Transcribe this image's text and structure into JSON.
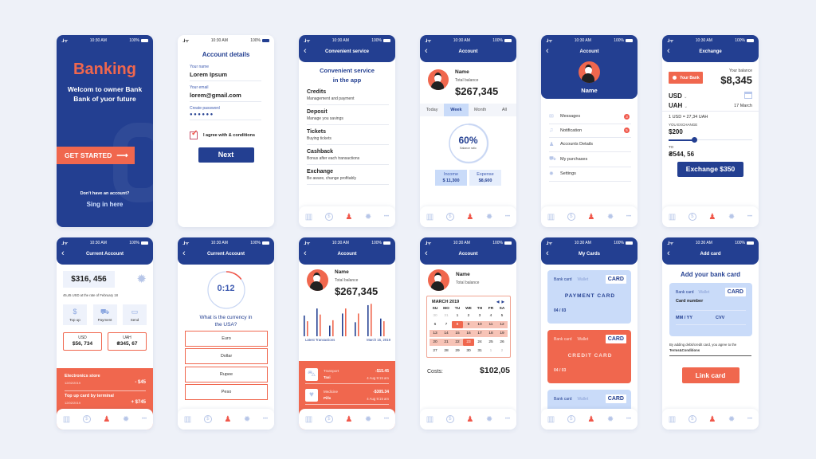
{
  "status_bar": {
    "time": "10:30 AM",
    "battery": "100%",
    "signal": "..ıl ᯤ"
  },
  "bottom_nav": {
    "icons": [
      "chart-icon",
      "dollar-icon",
      "profile-icon",
      "gear-icon",
      "more-icon"
    ],
    "glyphs": [
      "▥",
      "$",
      "♟",
      "✹",
      "•••"
    ]
  },
  "welcome": {
    "title": "Banking",
    "subtitle_line1": "Welcom to owner Bank",
    "subtitle_line2": "Bank of yuor future",
    "cta": "GET STARTED",
    "cta_arrow": "⟶",
    "no_account": "Don't have an account?",
    "sign_in": "Sing in here"
  },
  "account_details": {
    "title": "Account details",
    "fields": [
      {
        "label": "Your name",
        "value": "Lorem Ipsum"
      },
      {
        "label": "Your email",
        "value": "lorem@gmail.com"
      },
      {
        "label": "Create password",
        "value": "●●●●●●"
      }
    ],
    "checkbox_label": "I agree with & conditions",
    "checked": true,
    "next": "Next"
  },
  "services": {
    "header": "Convenient service",
    "title_line1": "Convenient service",
    "title_line2": "in the app",
    "items": [
      {
        "title": "Credits",
        "desc": "Management and payment"
      },
      {
        "title": "Deposit",
        "desc": "Manage you savings"
      },
      {
        "title": "Tickets",
        "desc": "Buying tickets"
      },
      {
        "title": "Cashback",
        "desc": "Bonus after each transactions"
      },
      {
        "title": "Exchange",
        "desc": "Be aware, change profitably"
      }
    ]
  },
  "account_ratio": {
    "header": "Account",
    "name": "Name",
    "balance_label": "Total balance",
    "balance": "$267,345",
    "tabs": [
      "Today",
      "Week",
      "Month",
      "All"
    ],
    "active_tab": "Week",
    "ratio": "60%",
    "ratio_value": 0.6,
    "ratio_label": "Balance ratio",
    "income_label": "Income",
    "income": "$ 11,300",
    "expense_label": "Expense",
    "expense": "$8,600"
  },
  "account_menu": {
    "header": "Account",
    "name": "Name",
    "items": [
      {
        "label": "Messages",
        "icon": "mail-icon",
        "glyph": "✉",
        "badge": "3"
      },
      {
        "label": "Notification",
        "icon": "bell-icon",
        "glyph": "♫",
        "badge": "5"
      },
      {
        "label": "Accounts Details",
        "icon": "user-icon",
        "glyph": "♟",
        "badge": ""
      },
      {
        "label": "My purchases",
        "icon": "cart-icon",
        "glyph": "⛟",
        "badge": ""
      },
      {
        "label": "Settings",
        "icon": "gear-icon",
        "glyph": "✹",
        "badge": ""
      }
    ]
  },
  "exchange": {
    "header": "Exchange",
    "bank": "Your Bank",
    "balance_label": "Your balance",
    "balance": "$8,345",
    "from": "USD",
    "to": "UAH",
    "date": "17 March",
    "rate": "1 USD = 27,34 UAH",
    "you_exchange_label": "YOU EXCHANGE",
    "amount": "$200",
    "slider_value": 0.3,
    "to_label": "TO",
    "result": "₴544, 56",
    "button": "Exchange $350"
  },
  "current_account": {
    "header": "Current Account",
    "balance": "$316, 456",
    "rate_note": "45,45 USD at the rate of February 18",
    "actions": [
      {
        "label": "Top up",
        "icon": "coin-icon",
        "glyph": "$"
      },
      {
        "label": "Payment",
        "icon": "cart-icon",
        "glyph": "⛟"
      },
      {
        "label": "Send",
        "icon": "wallet-icon",
        "glyph": "▭"
      }
    ],
    "currencies": [
      {
        "code": "USD",
        "amount": "$56, 734"
      },
      {
        "code": "UAH",
        "amount": "₴345, 67"
      }
    ],
    "transactions": [
      {
        "title": "Electronics store",
        "date": "12/02/2019",
        "amount": "- $45"
      },
      {
        "title": "Top up card by terminal",
        "date": "12/02/2019",
        "amount": "+ $745"
      }
    ]
  },
  "quiz": {
    "header": "Current Account",
    "timer": "0:12",
    "timer_progress": 0.15,
    "question_line1": "What is the currency in",
    "question_line2": "the USA?",
    "options": [
      "Euro",
      "Dollar",
      "Rupee",
      "Peso"
    ]
  },
  "transactions_screen": {
    "header": "Account",
    "name": "Name",
    "balance_label": "Total balance",
    "balance": "$267,345",
    "chart_left_label": "Latest Transactions",
    "chart_right_label": "March 15, 2019",
    "bars": [
      {
        "blue": 0.62,
        "orange": 0.45
      },
      {
        "blue": 0.83,
        "orange": 0.65
      },
      {
        "blue": 0.32,
        "orange": 0.48
      },
      {
        "blue": 0.68,
        "orange": 0.83
      },
      {
        "blue": 0.42,
        "orange": 0.68
      },
      {
        "blue": 0.93,
        "orange": 0.97
      },
      {
        "blue": 0.53,
        "orange": 0.45
      }
    ],
    "series_colors": {
      "blue": "#233f91",
      "orange": "#f0674e"
    },
    "items": [
      {
        "category": "Transport",
        "name": "Taxi",
        "amount": "-$15.45",
        "time": "4 Aug 9:15 am",
        "icon": "car-icon",
        "glyph": "⛍"
      },
      {
        "category": "Medicine",
        "name": "Pills",
        "amount": "-$305.34",
        "time": "4 Aug 9:15 am",
        "icon": "heart-icon",
        "glyph": "♥"
      }
    ]
  },
  "calendar_screen": {
    "header": "Account",
    "name": "Name",
    "balance_label": "Total balance",
    "month": "MARCH 2019",
    "prev": "◀",
    "next": "▶",
    "weekdays": [
      "SU",
      "MO",
      "TU",
      "WE",
      "TH",
      "FR",
      "SA"
    ],
    "days": [
      [
        "30",
        "31",
        "1",
        "2",
        "3",
        "4",
        "5"
      ],
      [
        "6",
        "7",
        "8",
        "9",
        "10",
        "11",
        "12"
      ],
      [
        "13",
        "14",
        "15",
        "16",
        "17",
        "18",
        "19"
      ],
      [
        "20",
        "21",
        "22",
        "23",
        "24",
        "25",
        "26"
      ],
      [
        "27",
        "28",
        "29",
        "30",
        "31",
        "1",
        "2"
      ]
    ],
    "range_start": "8",
    "range_end": "23",
    "costs_label": "Costs:",
    "costs": "$102,05"
  },
  "my_cards": {
    "header": "My Cards",
    "cards": [
      {
        "tab1": "Bank card",
        "tab2": "Wallet",
        "badge": "CARD",
        "name": "PAYMENT CARD",
        "expiry": "04 / 03",
        "style": "blue"
      },
      {
        "tab1": "Bank card",
        "tab2": "Wallet",
        "badge": "CARD",
        "name": "CREDIT CARD",
        "expiry": "04 / 03",
        "style": "orange"
      },
      {
        "tab1": "Bank card",
        "tab2": "Wallet",
        "badge": "CARD",
        "name": "",
        "expiry": "",
        "style": "blue"
      }
    ]
  },
  "add_card": {
    "header": "Add card",
    "title": "Add your bank card",
    "tab1": "Bank card",
    "tab2": "Wallet",
    "badge": "CARD",
    "card_number_placeholder": "Card number",
    "expiry_placeholder": "MM / YY",
    "cvv_placeholder": "CVV",
    "terms_text": "By adding debit/credit card, you agree to the",
    "terms_link": "Terms&Conditions",
    "button": "Link card"
  }
}
